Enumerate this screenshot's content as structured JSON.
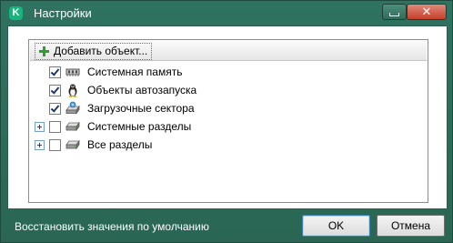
{
  "window": {
    "title": "Настройки",
    "app_icon": "kaspersky-k-icon",
    "controls": {
      "minimize": "minimize-icon",
      "close": "close-icon"
    }
  },
  "toolbar": {
    "add_label": "Добавить объект..."
  },
  "tree": {
    "items": [
      {
        "label": "Системная память",
        "checked": true,
        "expandable": false,
        "icon": "memory-chip-icon"
      },
      {
        "label": "Объекты автозапуска",
        "checked": true,
        "expandable": false,
        "icon": "tux-penguin-icon"
      },
      {
        "label": "Загрузочные сектора",
        "checked": true,
        "expandable": false,
        "icon": "boot-sector-drive-icon"
      },
      {
        "label": "Системные разделы",
        "checked": false,
        "expandable": true,
        "icon": "hard-drive-icon"
      },
      {
        "label": "Все разделы",
        "checked": false,
        "expandable": true,
        "icon": "hard-drive-icon"
      }
    ]
  },
  "footer": {
    "restore_label": "Восстановить значения по умолчанию",
    "ok_label": "OK",
    "cancel_label": "Отмена"
  },
  "colors": {
    "window": "#2e6a56",
    "close_button": "#c7402b",
    "check": "#1f3a6a"
  }
}
